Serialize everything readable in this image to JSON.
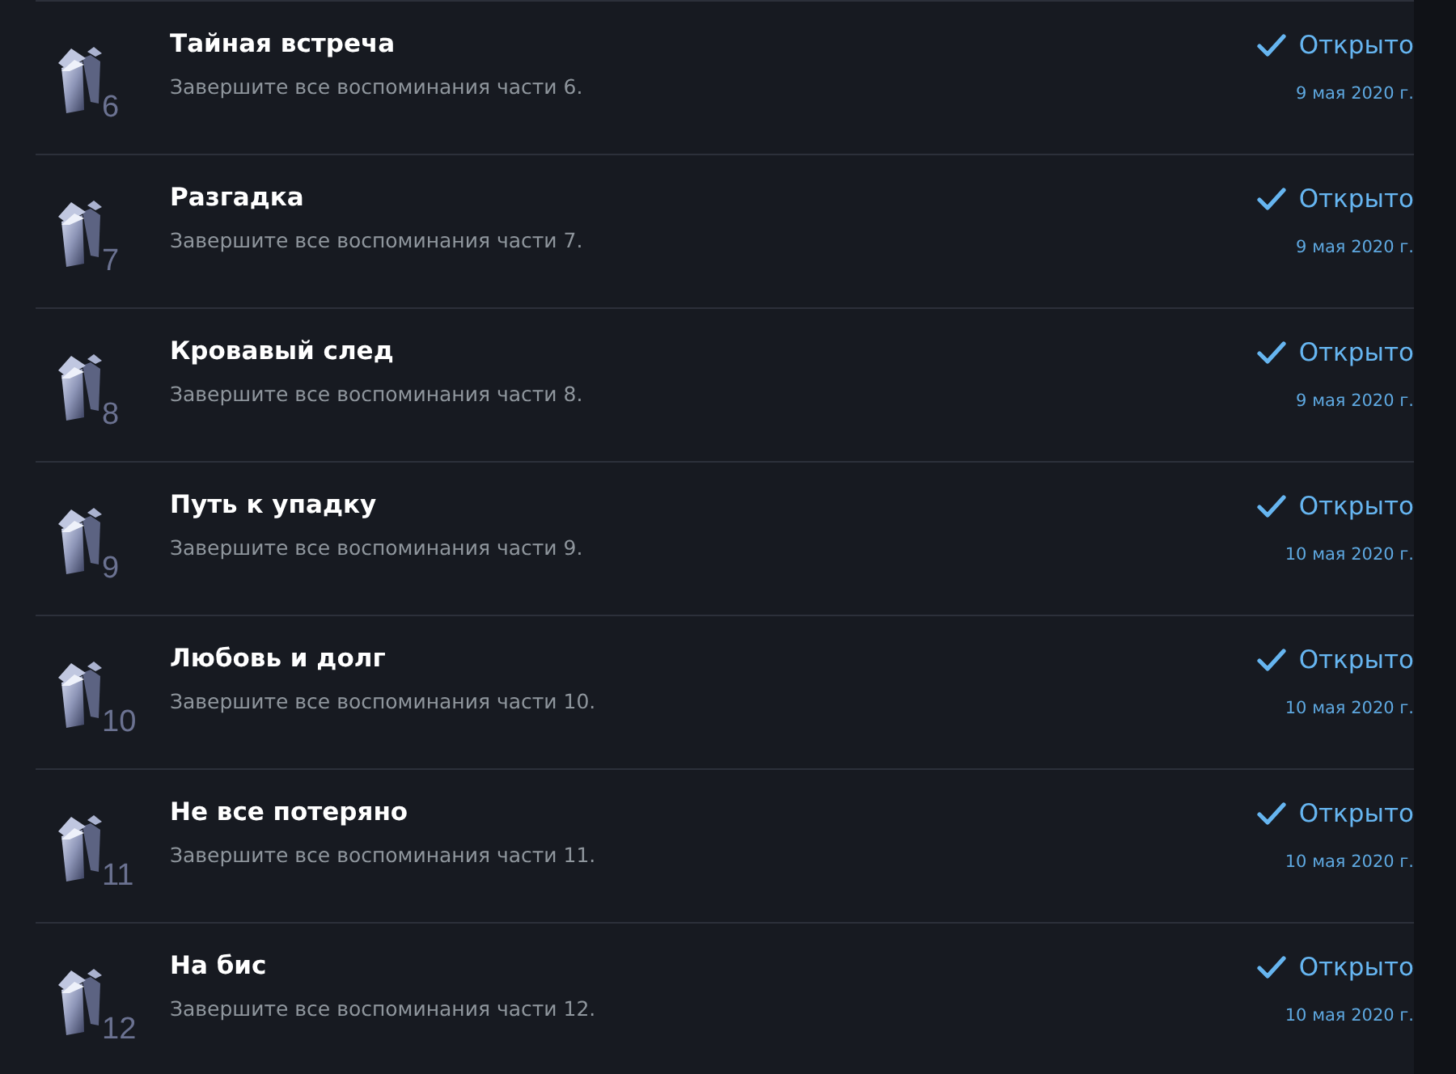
{
  "achievements": [
    {
      "icon_number": "6",
      "title": "Тайная встреча",
      "description": "Завершите все воспоминания части 6.",
      "unlocked": true,
      "status": "Открыто",
      "date": "9 мая 2020 г."
    },
    {
      "icon_number": "7",
      "title": "Разгадка",
      "description": "Завершите все воспоминания части 7.",
      "unlocked": true,
      "status": "Открыто",
      "date": "9 мая 2020 г."
    },
    {
      "icon_number": "8",
      "title": "Кровавый след",
      "description": "Завершите все воспоминания части 8.",
      "unlocked": true,
      "status": "Открыто",
      "date": "9 мая 2020 г."
    },
    {
      "icon_number": "9",
      "title": "Путь к упадку",
      "description": "Завершите все воспоминания части 9.",
      "unlocked": true,
      "status": "Открыто",
      "date": "10 мая 2020 г."
    },
    {
      "icon_number": "10",
      "title": "Любовь и долг",
      "description": "Завершите все воспоминания части 10.",
      "unlocked": true,
      "status": "Открыто",
      "date": "10 мая 2020 г."
    },
    {
      "icon_number": "11",
      "title": "Не все потеряно",
      "description": "Завершите все воспоминания части 11.",
      "unlocked": true,
      "status": "Открыто",
      "date": "10 мая 2020 г."
    },
    {
      "icon_number": "12",
      "title": "На бис",
      "description": "Завершите все воспоминания части 12.",
      "unlocked": true,
      "status": "Открыто",
      "date": "10 мая 2020 г."
    }
  ]
}
